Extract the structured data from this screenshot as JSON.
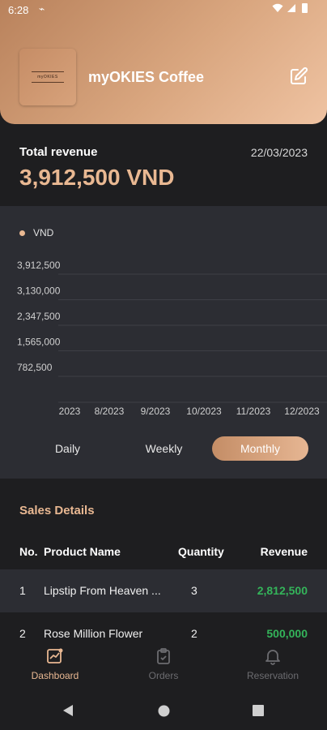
{
  "status_bar": {
    "time": "6:28"
  },
  "header": {
    "store_name": "myOKIES Coffee",
    "logo_text": "myOKIES"
  },
  "revenue": {
    "label": "Total revenue",
    "date": "22/03/2023",
    "amount": "3,912,500 VND"
  },
  "chart_data": {
    "type": "line",
    "legend": [
      "VND"
    ],
    "y_ticks": [
      "3,912,500",
      "3,130,000",
      "2,347,500",
      "1,565,000",
      "782,500"
    ],
    "x_ticks": [
      "2023",
      "8/2023",
      "9/2023",
      "10/2023",
      "11/2023",
      "12/2023"
    ],
    "series": [
      {
        "name": "VND",
        "values": []
      }
    ],
    "grid": true,
    "legend_position": "top-left",
    "color": "#e9b892"
  },
  "period_tabs": [
    {
      "label": "Daily",
      "active": false
    },
    {
      "label": "Weekly",
      "active": false
    },
    {
      "label": "Monthly",
      "active": true
    }
  ],
  "sales": {
    "title": "Sales Details",
    "columns": {
      "no": "No.",
      "name": "Product Name",
      "qty": "Quantity",
      "revenue": "Revenue"
    },
    "rows": [
      {
        "no": "1",
        "name": "Lipstip From Heaven ...",
        "qty": "3",
        "revenue": "2,812,500"
      },
      {
        "no": "2",
        "name": "Rose Million Flower",
        "qty": "2",
        "revenue": "500,000"
      }
    ]
  },
  "bottom_nav": [
    {
      "label": "Dashboard",
      "icon": "dashboard-icon",
      "active": true
    },
    {
      "label": "Orders",
      "icon": "clipboard-icon",
      "active": false
    },
    {
      "label": "Reservation",
      "icon": "bell-icon",
      "active": false
    }
  ],
  "colors": {
    "accent": "#e9b892",
    "positive": "#34b45a",
    "panel": "#2c2d33",
    "background": "#1e1e20"
  }
}
